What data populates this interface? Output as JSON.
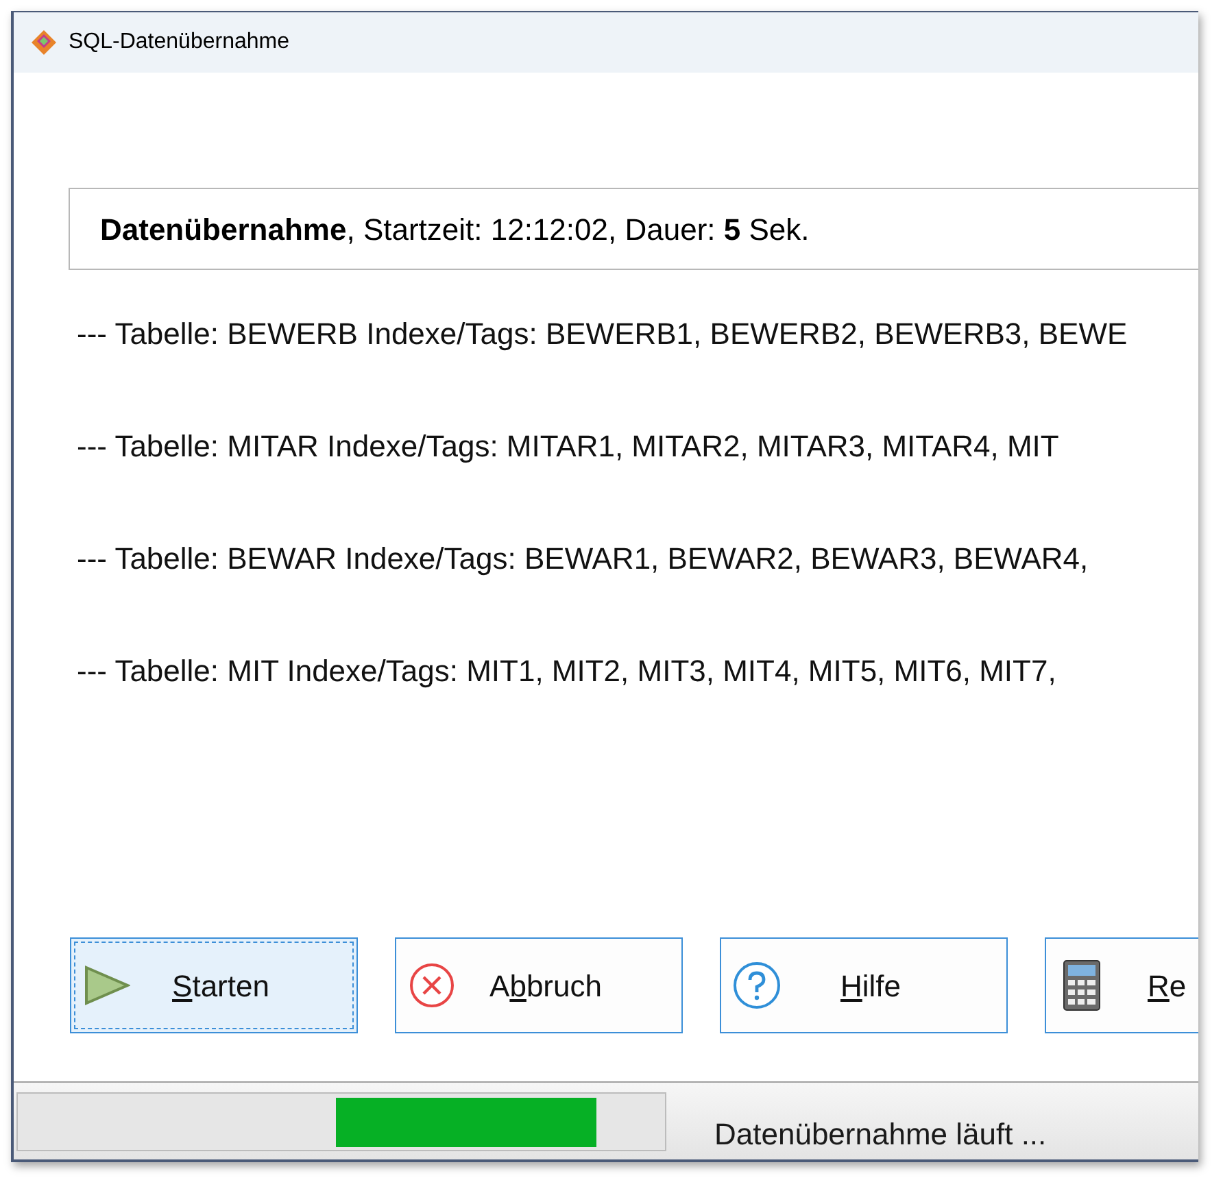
{
  "window": {
    "title": "SQL-Datenübernahme"
  },
  "summary": "**Datenübernahme**, Startzeit: 12:12:02, Dauer: **5** Sek.",
  "log_lines": [
    "--- Tabelle: BEWERB Indexe/Tags: BEWERB1, BEWERB2, BEWERB3, BEWE",
    "--- Tabelle: MITAR Indexe/Tags: MITAR1, MITAR2, MITAR3, MITAR4, MIT",
    "--- Tabelle: BEWAR Indexe/Tags: BEWAR1, BEWAR2, BEWAR3, BEWAR4,",
    "--- Tabelle: MIT Indexe/Tags: MIT1, MIT2, MIT3, MIT4, MIT5, MIT6, MIT7,"
  ],
  "buttons": [
    {
      "kind": "start",
      "key": "S",
      "after": "tarten",
      "focused": true
    },
    {
      "kind": "cancel",
      "before": "A",
      "key": "b",
      "after": "bruch",
      "focused": false
    },
    {
      "kind": "help",
      "key": "H",
      "after": "ilfe",
      "focused": false
    },
    {
      "kind": "calculator",
      "key": "R",
      "after": "e",
      "focused": false
    }
  ],
  "status_bar": {
    "progress": {
      "kind": "marquee"
    },
    "text": "Datenübernahme läuft ..."
  }
}
